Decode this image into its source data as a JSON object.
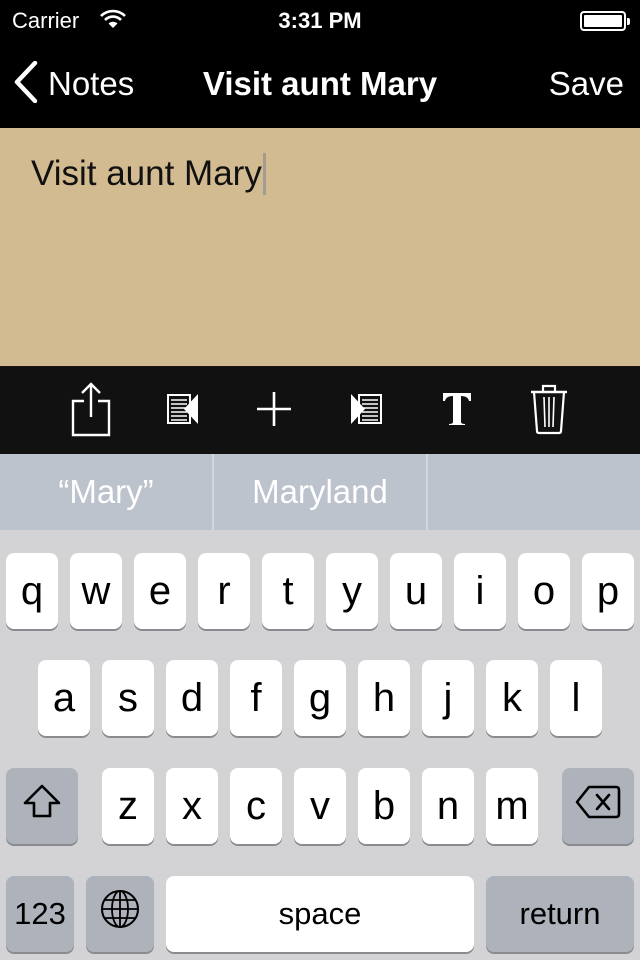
{
  "status_bar": {
    "carrier": "Carrier",
    "time": "3:31 PM",
    "battery_level": 1.0
  },
  "nav": {
    "back_label": "Notes",
    "title": "Visit aunt Mary",
    "save_label": "Save"
  },
  "note": {
    "text": "Visit aunt Mary",
    "background": "#d3bb91"
  },
  "toolbar": {
    "icons": [
      "share-icon",
      "previous-note-icon",
      "add-icon",
      "next-note-icon",
      "font-icon",
      "trash-icon"
    ]
  },
  "suggestions": [
    "“Mary”",
    "Maryland",
    ""
  ],
  "keyboard": {
    "row1": [
      "q",
      "w",
      "e",
      "r",
      "t",
      "y",
      "u",
      "i",
      "o",
      "p"
    ],
    "row2": [
      "a",
      "s",
      "d",
      "f",
      "g",
      "h",
      "j",
      "k",
      "l"
    ],
    "row3": [
      "z",
      "x",
      "c",
      "v",
      "b",
      "n",
      "m"
    ],
    "numbers_label": "123",
    "space_label": "space",
    "return_label": "return"
  }
}
